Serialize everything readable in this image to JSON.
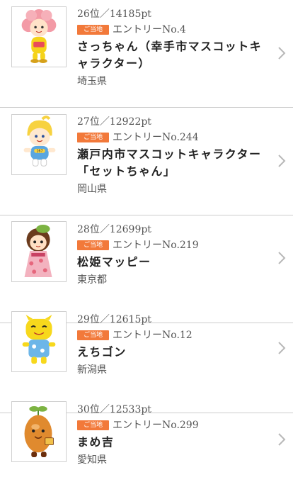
{
  "entries": [
    {
      "rank": "26位／14185pt",
      "badge": "ご当地",
      "entry": "エントリーNo.4",
      "name": "さっちゃん（幸手市マスコットキャラクター）",
      "prefecture": "埼玉県",
      "image_icon": "mascot-flower-girl-icon"
    },
    {
      "rank": "27位／12922pt",
      "badge": "ご当地",
      "entry": "エントリーNo.244",
      "name": "瀬戸内市マスコットキャラクター「セットちゃん」",
      "prefecture": "岡山県",
      "image_icon": "mascot-blue-boy-icon"
    },
    {
      "rank": "28位／12699pt",
      "badge": "ご当地",
      "entry": "エントリーNo.219",
      "name": "松姫マッピー",
      "prefecture": "東京都",
      "image_icon": "mascot-kimono-girl-icon"
    },
    {
      "rank": "29位／12615pt",
      "badge": "ご当地",
      "entry": "エントリーNo.12",
      "name": "えちゴン",
      "prefecture": "新潟県",
      "image_icon": "mascot-yellow-dragon-icon"
    },
    {
      "rank": "30位／12533pt",
      "badge": "ご当地",
      "entry": "エントリーNo.299",
      "name": "まめ吉",
      "prefecture": "愛知県",
      "image_icon": "mascot-bean-icon"
    }
  ],
  "colors": {
    "badge": "#f2793a",
    "divider": "#cccccc",
    "chevron": "#b8b8b8"
  }
}
